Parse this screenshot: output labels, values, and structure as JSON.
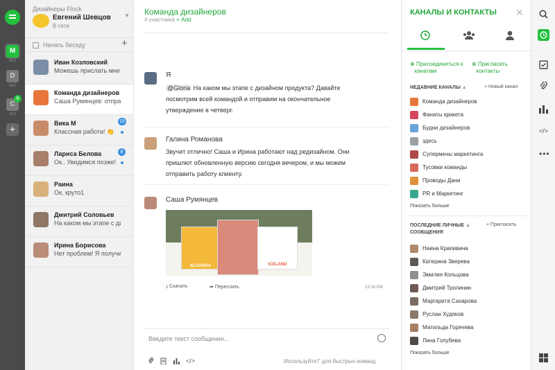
{
  "workspaces": [
    {
      "label": "M",
      "num": "№1"
    },
    {
      "label": "D",
      "num": "№2"
    },
    {
      "label": "C",
      "num": "№3"
    }
  ],
  "workspace_badge": "8",
  "team": {
    "name": "Дизайнеры Flock",
    "user": "Евгений Шевцов",
    "status": "В сети"
  },
  "new_chat": "Начать беседу",
  "chats": [
    {
      "name": "Иван Козловский",
      "preview": "Можешь прислать мне с",
      "badge": "",
      "color": "#7b8fa6"
    },
    {
      "name": "Команда дизайнеров",
      "preview": "Саша Румянцев: отправ",
      "badge": "",
      "color": "#e8763c"
    },
    {
      "name": "Вика М",
      "preview": "Классная работа! 👏",
      "badge": "15",
      "color": "#c98c6a"
    },
    {
      "name": "Лариса Белова",
      "preview": "Ок.. Увидимся позже!",
      "badge": "8",
      "color": "#a87f6b"
    },
    {
      "name": "Раина",
      "preview": "Ок, круто1",
      "badge": "",
      "color": "#d8b27a"
    },
    {
      "name": "Дмитрий Соловьев",
      "preview": "На каком мы этапе с ди",
      "badge": "",
      "color": "#8f7765"
    },
    {
      "name": "Ирина Борисова",
      "preview": "Нет проблем! Я получи",
      "badge": "",
      "color": "#b98d78"
    }
  ],
  "conversation": {
    "title": "Команда дизайнеров",
    "members": "4 участника",
    "add": "+ Add"
  },
  "messages": {
    "m1": {
      "author": "Я",
      "mention": "@Gloria",
      "text": "На каком мы этапе с дизайном продукта? Давайте посмотрим всей командой и отправим на окончательное утверждение в четверг."
    },
    "m2": {
      "author": "Галина Романова",
      "text": "Звучит отлично! Саша и Ирина работают над редизайном. Они пришлют обновленную версию сегодня вечером, и мы можем отправить работу клиенту."
    },
    "m3": {
      "author": "Саша Румянцев",
      "download": "Скачать",
      "forward": "Переслать",
      "time": "12:16 PM",
      "cards": [
        "SLOVAKIA",
        "ICELAND"
      ]
    }
  },
  "composer": {
    "placeholder": "Введите текст сообщения...",
    "hint": "Используйте'/' для быстрых команд"
  },
  "panel": {
    "title": "КАНАЛЫ И КОНТАКТЫ",
    "join": [
      "Присоединиться к",
      "каналам"
    ],
    "invite": [
      "Пригласить",
      "контакты"
    ],
    "recent_channels_label": "НЕДАВНИЕ КАНАЛЫ",
    "new_channel": "+ Новый канал",
    "channels": [
      {
        "name": "Команда дизайнеров",
        "color": "#e8763c"
      },
      {
        "name": "Фанаты крикета",
        "color": "#d6455d"
      },
      {
        "name": "Будни дизайнеров",
        "color": "#6aa3d8"
      },
      {
        "name": "здесь",
        "color": "#9aa0a6"
      },
      {
        "name": "Супермены маркетинга",
        "color": "#b04a4a"
      },
      {
        "name": "Тусовки команды",
        "color": "#d86a5c"
      },
      {
        "name": "Проводы Дани",
        "color": "#e0913d"
      },
      {
        "name": "PR и Маркетинг",
        "color": "#3aa78f"
      }
    ],
    "show_more": "Показать больше",
    "recent_dm_label": [
      "ПОСЛЕДНИЕ ЛИЧНЫЕ",
      "СООБЩЕНИЯ"
    ],
    "invite_short": "+ Пригласить",
    "contacts": [
      {
        "name": "Наина Крапивина",
        "color": "#b08a6e"
      },
      {
        "name": "Катерина Зверева",
        "color": "#5f5a58"
      },
      {
        "name": "Эмилия Кольцова",
        "color": "#8f8f8f"
      },
      {
        "name": "Дмитрий Тропинин",
        "color": "#6d5b52"
      },
      {
        "name": "Маргарита Сахарова",
        "color": "#7b6a64"
      },
      {
        "name": "Руслан Худяков",
        "color": "#8a7a6a"
      },
      {
        "name": "Матильда Горячева",
        "color": "#a67e66"
      },
      {
        "name": "Лина Голубева",
        "color": "#4e4a48"
      }
    ]
  },
  "colors": {
    "accent": "#21c23e",
    "accent_text": "#21a83a",
    "badge": "#3b8ee0"
  }
}
